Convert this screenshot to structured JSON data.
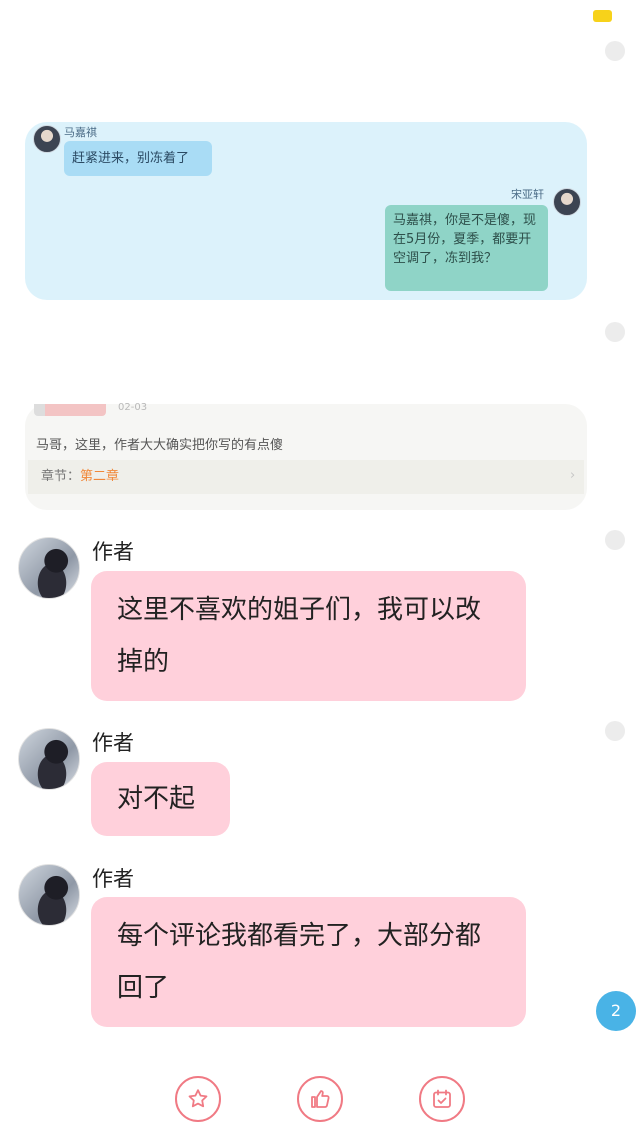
{
  "embedded_chat": {
    "left_name": "马嘉祺",
    "left_message": "赶紧进来，别冻着了",
    "right_name": "宋亚轩",
    "right_message": "马嘉祺，你是不是傻，现在5月份，夏季，都要开空调了，冻到我？"
  },
  "embedded_comment": {
    "date": "02-03",
    "text": "马哥，这里，作者大大确实把你写的有点傻",
    "chapter_label": "章节：",
    "chapter_value": "第二章"
  },
  "messages": [
    {
      "author": "作者",
      "text": "这里不喜欢的姐子们，我可以改掉的"
    },
    {
      "author": "作者",
      "text": "对不起"
    },
    {
      "author": "作者",
      "text": "每个评论我都看完了，大部分都回了"
    }
  ],
  "badge_count": "2",
  "actions": [
    {
      "icon": "star-icon"
    },
    {
      "icon": "thumbs-up-icon"
    },
    {
      "icon": "calendar-check-icon"
    }
  ],
  "colors": {
    "bubble": "#ffd0db",
    "accent": "#f07a84",
    "badge": "#49b3e6"
  }
}
